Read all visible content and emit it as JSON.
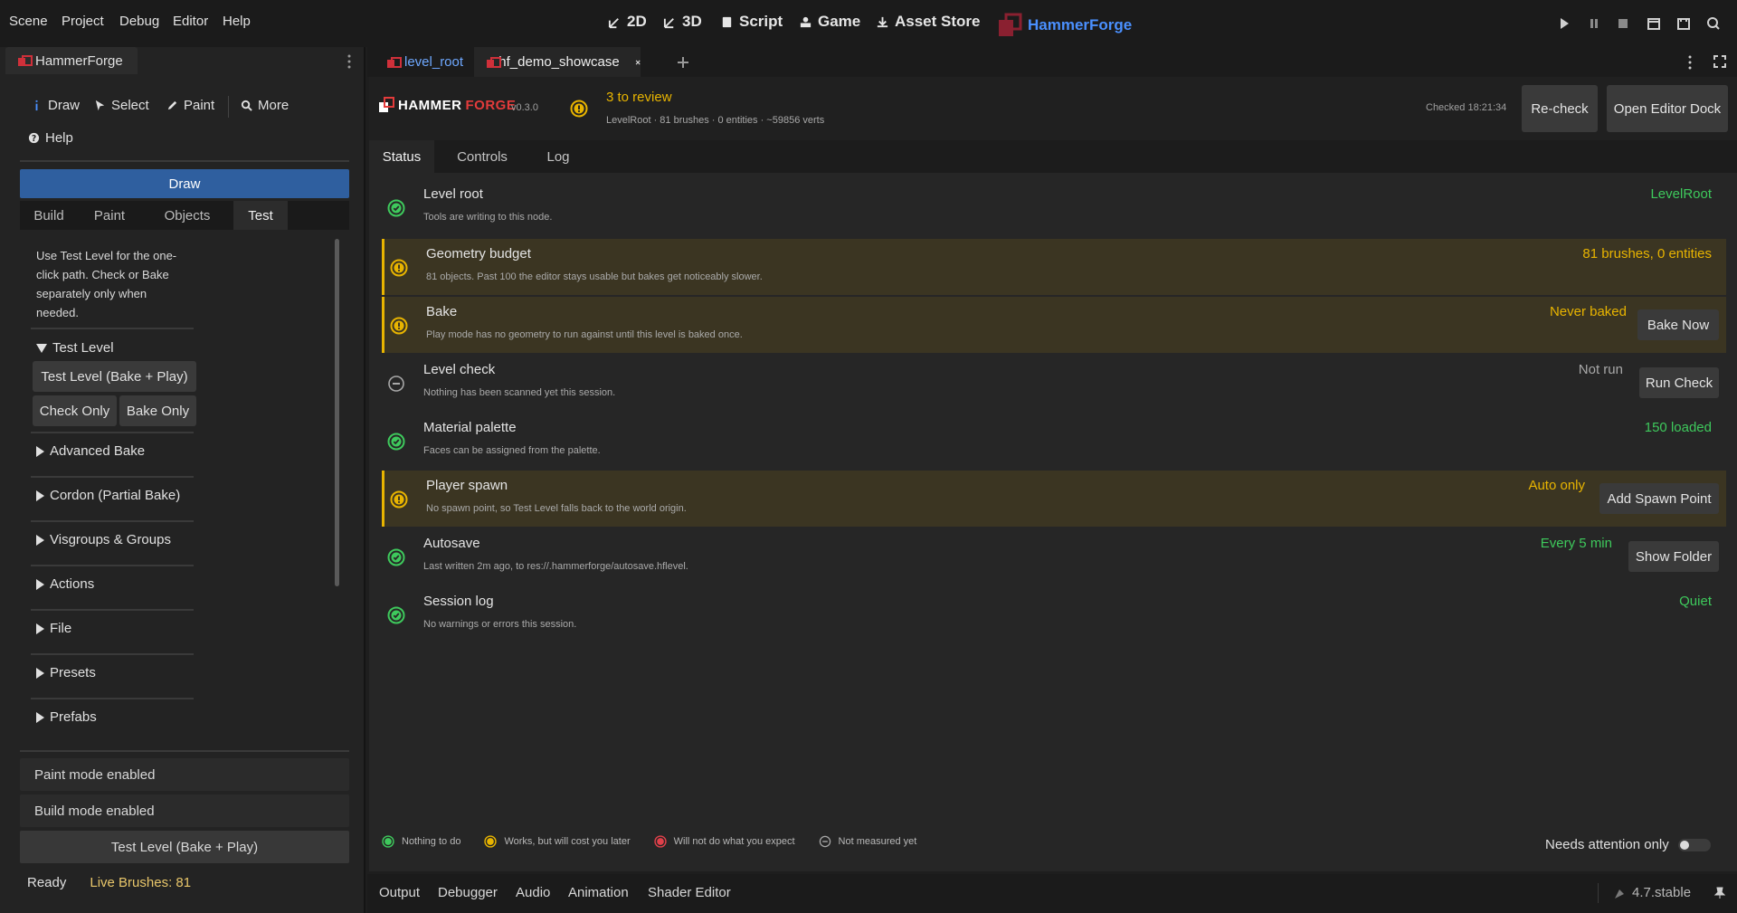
{
  "menu": [
    "Scene",
    "Project",
    "Debug",
    "Editor",
    "Help"
  ],
  "workspaces": [
    "2D",
    "3D",
    "Script",
    "Game",
    "Asset Store"
  ],
  "brand": "HammerForge",
  "left_dock": {
    "tab": "HammerForge",
    "tools": [
      "Draw",
      "Select",
      "Paint",
      "More",
      "Help"
    ],
    "mode_bar": "Draw",
    "subtabs": [
      "Build",
      "Paint",
      "Objects",
      "Test"
    ],
    "active_subtab": "Test",
    "info_text": "Use Test Level for the one-click path. Check or Bake separately only when needed.",
    "test_level_section": "Test Level",
    "buttons": {
      "test_level": "Test Level  (Bake + Play)",
      "check_only": "Check Only",
      "bake_only": "Bake Only"
    },
    "sections": [
      "Advanced Bake",
      "Cordon (Partial Bake)",
      "Visgroups & Groups",
      "Actions",
      "File",
      "Presets",
      "Prefabs"
    ],
    "status_lines": [
      "Paint mode enabled",
      "Build mode enabled",
      "Test Level  (Bake + Play)"
    ],
    "ready": "Ready",
    "live_brushes": "Live Brushes: 81"
  },
  "editor_tabs": [
    {
      "label": "level_root",
      "active": false
    },
    {
      "label": "hf_demo_showcase",
      "active": true
    }
  ],
  "header": {
    "logo_a": "HAMMER",
    "logo_b": "FORGE",
    "version": "v0.3.0",
    "review_title": "3 to review",
    "review_sub": "LevelRoot · 81 brushes · 0 entities · ~59856 verts",
    "checked": "Checked 18:21:34",
    "recheck": "Re-check",
    "open_dock": "Open Editor Dock"
  },
  "status_tabs": [
    "Status",
    "Controls",
    "Log"
  ],
  "rows": [
    {
      "title": "Level root",
      "desc": "Tools are writing to this node.",
      "value": "LevelRoot",
      "state": "ok",
      "button": ""
    },
    {
      "title": "Geometry budget",
      "desc": "81 objects. Past 100 the editor stays usable but bakes get noticeably slower.",
      "value": "81 brushes, 0 entities",
      "state": "warn",
      "button": ""
    },
    {
      "title": "Bake",
      "desc": "Play mode has no geometry to run against until this level is baked once.",
      "value": "Never baked",
      "state": "warn",
      "button": "Bake Now"
    },
    {
      "title": "Level check",
      "desc": "Nothing has been scanned yet this session.",
      "value": "Not run",
      "state": "none",
      "button": "Run Check"
    },
    {
      "title": "Material palette",
      "desc": "Faces can be assigned from the palette.",
      "value": "150 loaded",
      "state": "ok",
      "button": ""
    },
    {
      "title": "Player spawn",
      "desc": "No spawn point, so Test Level falls back to the world origin.",
      "value": "Auto only",
      "state": "warn",
      "button": "Add Spawn Point"
    },
    {
      "title": "Autosave",
      "desc": "Last written 2m ago, to res://.hammerforge/autosave.hflevel.",
      "value": "Every 5 min",
      "state": "ok",
      "button": "Show Folder"
    },
    {
      "title": "Session log",
      "desc": "No warnings or errors this session.",
      "value": "Quiet",
      "state": "ok",
      "button": ""
    }
  ],
  "legend": [
    "Nothing to do",
    "Works, but will cost you later",
    "Will not do what you expect",
    "Not measured yet"
  ],
  "attention_label": "Needs attention only",
  "bottom_tabs": [
    "Output",
    "Debugger",
    "Audio",
    "Animation",
    "Shader Editor"
  ],
  "engine_version": "4.7.stable",
  "colors": {
    "ok": "#3ec95c",
    "warn": "#e8b400",
    "error": "#e0404a",
    "accent": "#2f5f9f",
    "brand": "#4a90ff"
  }
}
